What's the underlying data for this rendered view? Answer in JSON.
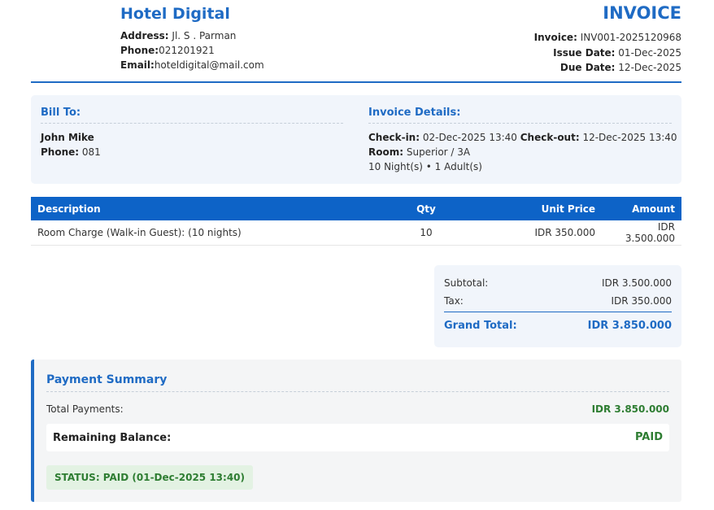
{
  "hotel": {
    "name": "Hotel Digital",
    "address_label": "Address:",
    "address": " Jl. S . Parman",
    "phone_label": "Phone:",
    "phone": "021201921",
    "email_label": "Email:",
    "email": "hoteldigital@mail.com"
  },
  "invoice": {
    "title": "INVOICE",
    "number_label": "Invoice:",
    "number": " INV001-2025120968",
    "issue_label": "Issue Date:",
    "issue_date": " 01-Dec-2025",
    "due_label": "Due Date:",
    "due_date": " 12-Dec-2025"
  },
  "bill_to": {
    "title": "Bill To:",
    "name": "John Mike",
    "phone_label": "Phone:",
    "phone": " 081"
  },
  "details": {
    "title": "Invoice Details:",
    "checkin_label": "Check-in:",
    "checkin": " 02-Dec-2025 13:40 ",
    "checkout_label": "Check-out:",
    "checkout": " 12-Dec-2025 13:40",
    "room_label": "Room:",
    "room": " Superior / 3A",
    "stay": "10 Night(s) • 1 Adult(s)"
  },
  "table": {
    "headers": {
      "description": "Description",
      "qty": "Qty",
      "unit_price": "Unit Price",
      "amount": "Amount"
    },
    "rows": [
      {
        "description": "Room Charge (Walk-in Guest): (10 nights)",
        "qty": "10",
        "unit_price": "IDR 350.000",
        "amount": "IDR 3.500.000"
      }
    ]
  },
  "totals": {
    "subtotal_label": "Subtotal:",
    "subtotal": "IDR 3.500.000",
    "tax_label": "Tax:",
    "tax": "IDR 350.000",
    "grand_label": "Grand Total:",
    "grand": "IDR 3.850.000"
  },
  "payment": {
    "title": "Payment Summary",
    "total_payments_label": "Total Payments:",
    "total_payments": "IDR 3.850.000",
    "remaining_label": "Remaining Balance:",
    "remaining": "PAID",
    "status": "STATUS: PAID (01-Dec-2025 13:40)"
  },
  "colors": {
    "accent": "#1f6bc4",
    "table_header": "#0d63c7",
    "success": "#2e7d32",
    "panel_bg": "#f1f5fb"
  }
}
